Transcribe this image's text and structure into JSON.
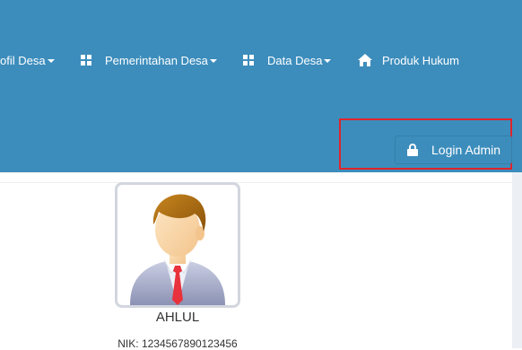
{
  "nav": {
    "items": [
      {
        "label": "ofil Desa",
        "has_caret": true
      },
      {
        "label": "Pemerintahan Desa",
        "has_caret": true,
        "icon": "grid-icon"
      },
      {
        "label": "Data Desa",
        "has_caret": true,
        "icon": "grid-icon"
      },
      {
        "label": "Produk Hukum",
        "has_caret": false,
        "icon": "home-icon"
      }
    ],
    "login_label": "Login Admin",
    "login_icon": "lock-icon"
  },
  "profile": {
    "name": "AHLUL",
    "nik": "NIK: 1234567890123456"
  },
  "colors": {
    "navbar": "#3c8dbc",
    "highlight": "#e0242a",
    "text": "#333333"
  }
}
